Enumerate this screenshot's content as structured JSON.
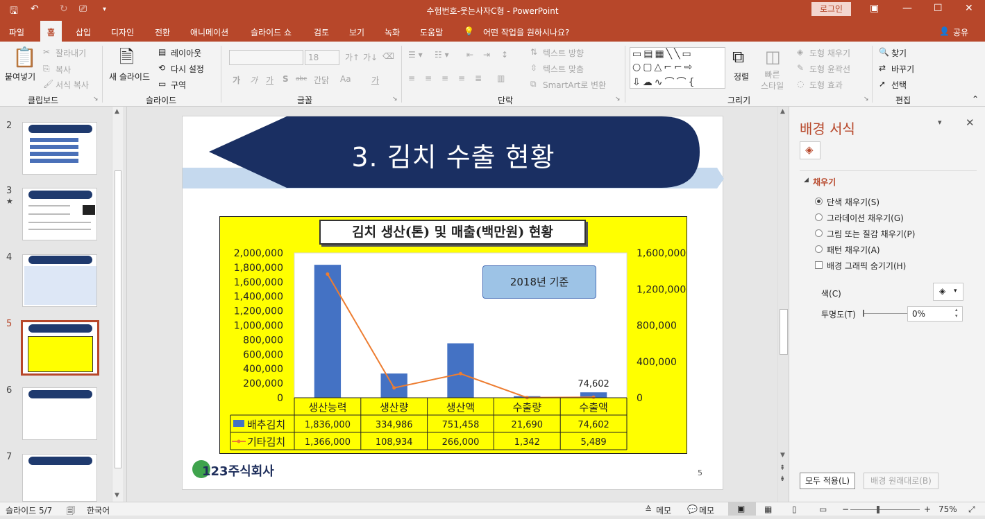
{
  "window": {
    "title": "수험번호-웃는사자C형  -  PowerPoint",
    "login": "로그인",
    "share": "공유"
  },
  "tabs": [
    "파일",
    "홈",
    "삽입",
    "디자인",
    "전환",
    "애니메이션",
    "슬라이드 쇼",
    "검토",
    "보기",
    "녹화",
    "도움말"
  ],
  "tell_me": "어떤 작업을 원하시나요?",
  "ribbon": {
    "clipboard": {
      "paste": "붙여넣기",
      "cut": "잘라내기",
      "copy": "복사",
      "format_painter": "서식 복사",
      "label": "클립보드"
    },
    "slides": {
      "new_slide": "새 슬라이드",
      "layout": "레이아웃",
      "reset": "다시 설정",
      "section": "구역",
      "label": "슬라이드"
    },
    "font": {
      "size": "18",
      "label": "글꼴",
      "sample_bold": "가",
      "sample_italic": "가",
      "sample_underline": "가",
      "sample_shadow": "S",
      "sample_strike": "abc",
      "spacing": "간닭",
      "case": "Aa",
      "color_a": "가"
    },
    "paragraph": {
      "label": "단락",
      "text_direction": "텍스트 방향",
      "align_text": "텍스트 맞춤",
      "smartart": "SmartArt로 변환"
    },
    "drawing": {
      "arrange": "정렬",
      "quick_styles": "빠른\n스타일",
      "shape_fill": "도형 채우기",
      "shape_outline": "도형 윤곽선",
      "shape_effects": "도형 효과",
      "label": "그리기"
    },
    "editing": {
      "find": "찾기",
      "replace": "바꾸기",
      "select": "선택",
      "label": "편집"
    }
  },
  "thumbnails": [
    {
      "num": "2",
      "star": ""
    },
    {
      "num": "3",
      "star": "★"
    },
    {
      "num": "4",
      "star": ""
    },
    {
      "num": "5",
      "star": ""
    },
    {
      "num": "6",
      "star": ""
    },
    {
      "num": "7",
      "star": ""
    }
  ],
  "slide": {
    "title": "3. 김치 수출 현황",
    "page_number": "5",
    "logo": "123주식회사"
  },
  "chart_data": {
    "type": "bar",
    "title": "김치 생산(톤) 및 매출(백만원) 현황",
    "annotation": "2018년 기준",
    "categories": [
      "생산능력",
      "생산량",
      "생산액",
      "수출량",
      "수출액"
    ],
    "series": [
      {
        "name": "배추김치",
        "type": "bar",
        "axis": "left",
        "color": "#4472c4",
        "values": [
          1836000,
          334986,
          751458,
          21690,
          74602
        ],
        "labels": [
          "1,836,000",
          "334,986",
          "751,458",
          "21,690",
          "74,602"
        ]
      },
      {
        "name": "기타김치",
        "type": "line",
        "axis": "right",
        "color": "#ed7d31",
        "values": [
          1366000,
          108934,
          266000,
          1342,
          5489
        ],
        "labels": [
          "1,366,000",
          "108,934",
          "266,000",
          "1,342",
          "5,489"
        ]
      }
    ],
    "data_label": "74,602",
    "ylim": [
      0,
      2000000
    ],
    "y2lim": [
      0,
      1600000
    ],
    "yticks": [
      "0",
      "200,000",
      "400,000",
      "600,000",
      "800,000",
      "1,000,000",
      "1,200,000",
      "1,400,000",
      "1,600,000",
      "1,800,000",
      "2,000,000"
    ],
    "y2ticks": [
      "0",
      "400,000",
      "800,000",
      "1,200,000",
      "1,600,000"
    ],
    "background": "#ffff00"
  },
  "format_pane": {
    "title": "배경 서식",
    "section": "채우기",
    "options": [
      "단색 채우기(S)",
      "그라데이션 채우기(G)",
      "그림 또는 질감 채우기(P)",
      "패턴 채우기(A)"
    ],
    "hide_graphics": "배경 그래픽 숨기기(H)",
    "color_label": "색(C)",
    "transparency_label": "투명도(T)",
    "transparency_value": "0%",
    "apply_all": "모두 적용(L)",
    "reset": "배경 원래대로(B)"
  },
  "status": {
    "slide": "슬라이드 5/7",
    "language": "한국어",
    "notes": "메모",
    "comments": "메모",
    "zoom": "75%"
  }
}
